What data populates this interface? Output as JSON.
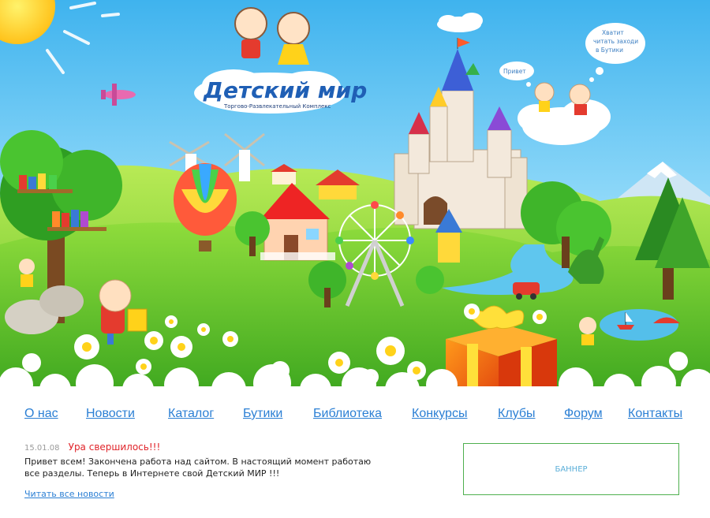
{
  "logo": {
    "title": "Детский мир",
    "subtitle": "Торгово-Развлекательный Комплекс"
  },
  "hero": {
    "bubble_hello": "Привет",
    "bubble_line1": "Хватит",
    "bubble_line2": "читать заходи",
    "bubble_line3": "в Бутики"
  },
  "nav": {
    "items": [
      {
        "label": "О нас"
      },
      {
        "label": "Новости"
      },
      {
        "label": "Каталог"
      },
      {
        "label": "Бутики"
      },
      {
        "label": "Библиотека"
      },
      {
        "label": "Конкурсы"
      },
      {
        "label": "Клубы"
      },
      {
        "label": "Форум"
      },
      {
        "label": "Контакты"
      }
    ]
  },
  "news": {
    "date": "15.01.08",
    "title": "Ура свершилось!!!",
    "body": "Привет всем!  Закончена работа над сайтом. В настоящий момент работаю все разделы. Теперь в Интернете свой Детский МИР !!!",
    "all_link": "Читать все новости"
  },
  "banner": {
    "label": "БАННЕР"
  },
  "colors": {
    "link": "#2b7fd4",
    "news_title": "#e0242a",
    "banner_border": "#4fb04f",
    "sky": "#7fd0f5",
    "grass": "#5cc23a"
  }
}
